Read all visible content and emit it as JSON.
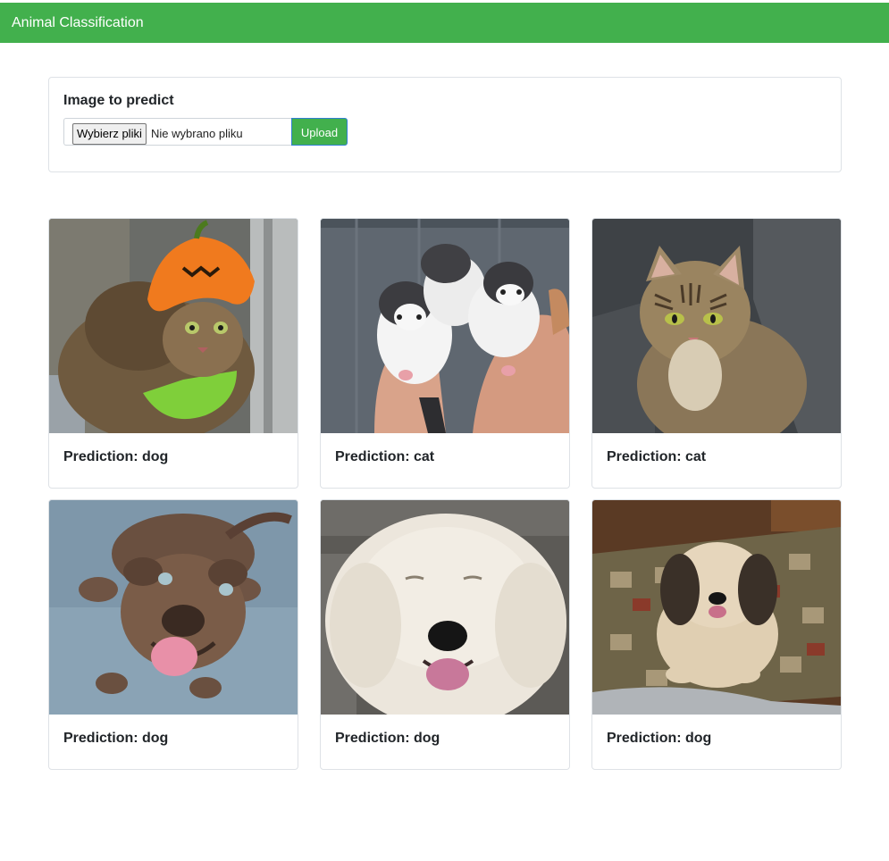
{
  "navbar": {
    "title": "Animal Classification"
  },
  "upload": {
    "title": "Image to predict",
    "choose_label": "Wybierz pliki",
    "status": "Nie wybrano pliku",
    "button_label": "Upload"
  },
  "colors": {
    "accent": "#42b04d",
    "border": "#dee2e6"
  },
  "predictions": [
    {
      "label": "Prediction: dog",
      "image": "tabby-cat-pumpkin-hat"
    },
    {
      "label": "Prediction: cat",
      "image": "three-kittens-held"
    },
    {
      "label": "Prediction: cat",
      "image": "tabby-cat-sitting"
    },
    {
      "label": "Prediction: dog",
      "image": "brown-pitbull-tongue-out"
    },
    {
      "label": "Prediction: dog",
      "image": "white-fluffy-dog-closeup"
    },
    {
      "label": "Prediction: dog",
      "image": "small-shaggy-dog-on-rug"
    }
  ]
}
